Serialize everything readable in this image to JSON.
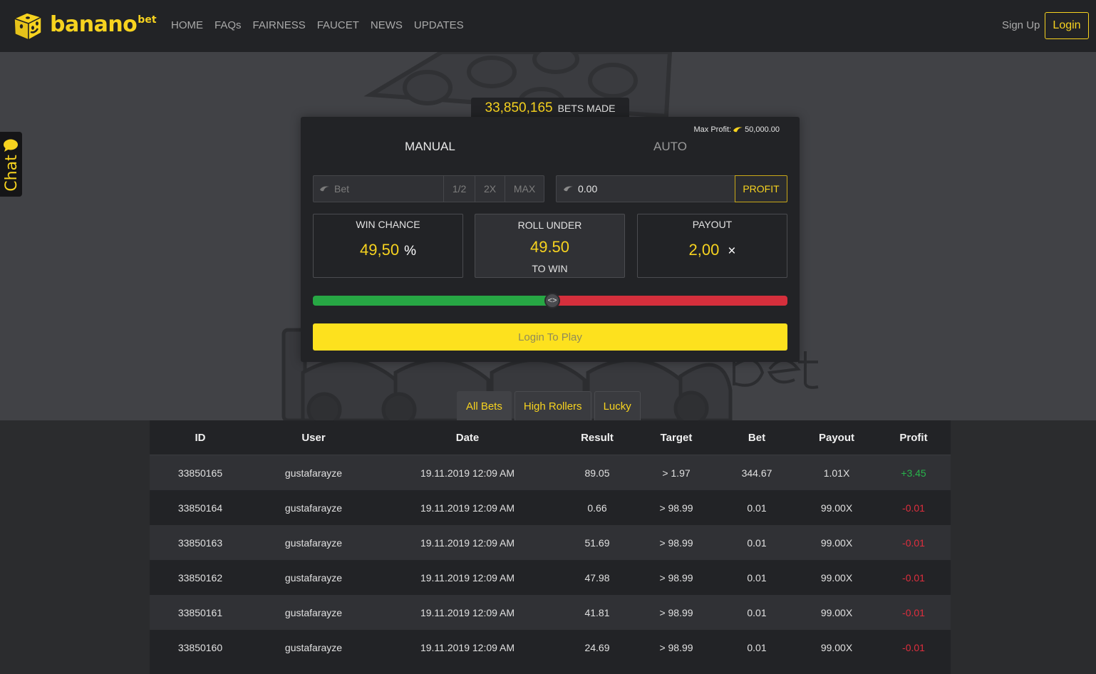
{
  "brand": {
    "name": "banano",
    "suffix": "bet",
    "accent": "#f7d31f"
  },
  "nav": {
    "items": [
      "HOME",
      "FAQs",
      "FAIRNESS",
      "FAUCET",
      "NEWS",
      "UPDATES"
    ],
    "sign_up": "Sign Up",
    "login": "Login"
  },
  "chat": {
    "label": "Chat"
  },
  "stats": {
    "bets_made_count": "33,850,165",
    "bets_made_label": "BETS MADE"
  },
  "game": {
    "max_profit_label": "Max Profit:",
    "max_profit_value": "50,000.00",
    "tabs": {
      "manual": "MANUAL",
      "auto": "AUTO"
    },
    "bet": {
      "placeholder": "Bet",
      "half": "1/2",
      "double": "2X",
      "max": "MAX"
    },
    "profit": {
      "value": "0.00",
      "button": "PROFIT"
    },
    "win_chance": {
      "title": "WIN CHANCE",
      "value": "49,50",
      "unit": "%"
    },
    "roll_under": {
      "title": "ROLL UNDER",
      "value": "49.50",
      "sub": "TO WIN"
    },
    "payout": {
      "title": "PAYOUT",
      "value": "2,00",
      "unit": "×"
    },
    "slider": {
      "value_percent": 50.5,
      "handle_glyph": "<>",
      "low_color": "#27a744",
      "high_color": "#d52f3c"
    },
    "play_button": "Login To Play"
  },
  "bet_tabs": [
    "All Bets",
    "High Rollers",
    "Lucky"
  ],
  "table": {
    "headers": [
      "ID",
      "User",
      "Date",
      "Result",
      "Target",
      "Bet",
      "Payout",
      "Profit"
    ],
    "rows": [
      [
        "33850165",
        "gustafarayze",
        "19.11.2019 12:09 AM",
        "89.05",
        "> 1.97",
        "344.67",
        "1.01X",
        "+3.45"
      ],
      [
        "33850164",
        "gustafarayze",
        "19.11.2019 12:09 AM",
        "0.66",
        "> 98.99",
        "0.01",
        "99.00X",
        "-0.01"
      ],
      [
        "33850163",
        "gustafarayze",
        "19.11.2019 12:09 AM",
        "51.69",
        "> 98.99",
        "0.01",
        "99.00X",
        "-0.01"
      ],
      [
        "33850162",
        "gustafarayze",
        "19.11.2019 12:09 AM",
        "47.98",
        "> 98.99",
        "0.01",
        "99.00X",
        "-0.01"
      ],
      [
        "33850161",
        "gustafarayze",
        "19.11.2019 12:09 AM",
        "41.81",
        "> 98.99",
        "0.01",
        "99.00X",
        "-0.01"
      ],
      [
        "33850160",
        "gustafarayze",
        "19.11.2019 12:09 AM",
        "24.69",
        "> 98.99",
        "0.01",
        "99.00X",
        "-0.01"
      ]
    ]
  }
}
